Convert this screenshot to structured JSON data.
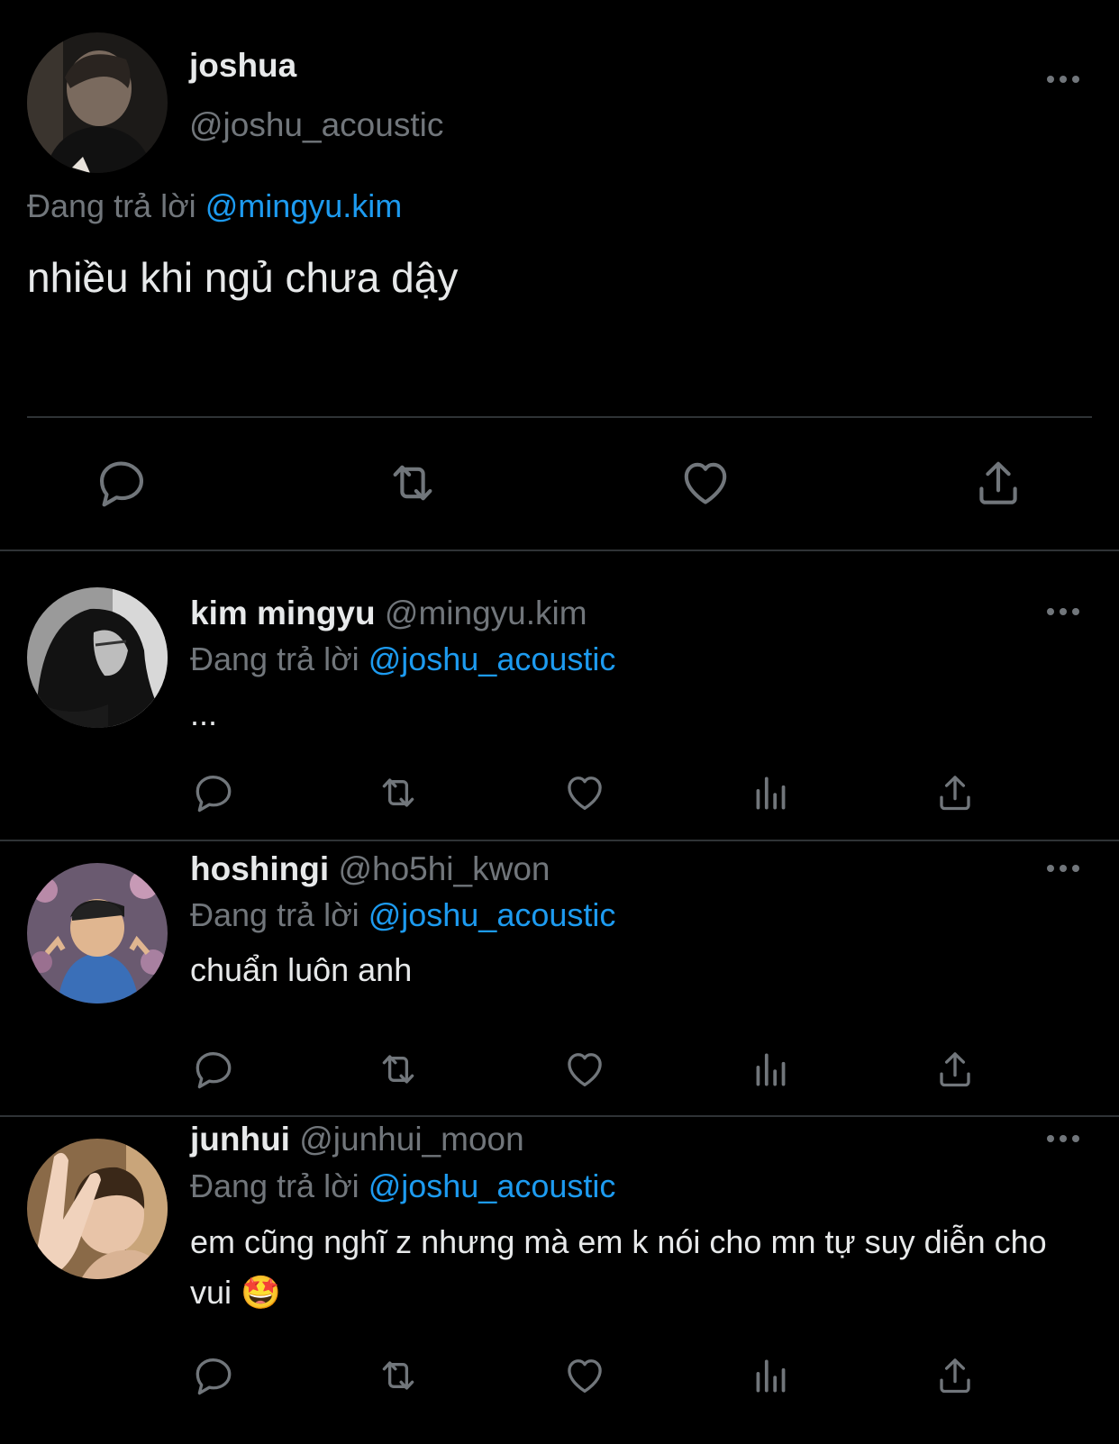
{
  "main_tweet": {
    "name": "joshua",
    "handle": "@joshu_acoustic",
    "replying_prefix": "Đang trả lời",
    "replying_to": "@mingyu.kim",
    "text": "nhiều khi ngủ chưa dậy"
  },
  "replies": [
    {
      "name": "kim mingyu",
      "handle": "@mingyu.kim",
      "replying_prefix": "Đang trả lời",
      "replying_to": "@joshu_acoustic",
      "text": "..."
    },
    {
      "name": "hoshingi",
      "handle": "@ho5hi_kwon",
      "replying_prefix": "Đang trả lời",
      "replying_to": "@joshu_acoustic",
      "text": "chuẩn luôn anh"
    },
    {
      "name": "junhui",
      "handle": "@junhui_moon",
      "replying_prefix": "Đang trả lời",
      "replying_to": "@joshu_acoustic",
      "text": "em cũng nghĩ z nhưng mà em k nói cho mn tự suy diễn cho vui 🤩"
    }
  ],
  "icons": [
    "reply-icon",
    "retweet-icon",
    "like-icon",
    "views-icon",
    "share-icon",
    "more-icon"
  ],
  "colors": {
    "background": "#000000",
    "text": "#e7e9ea",
    "secondary": "#71767b",
    "mention": "#1d9bf0",
    "divider": "#2f3336"
  }
}
